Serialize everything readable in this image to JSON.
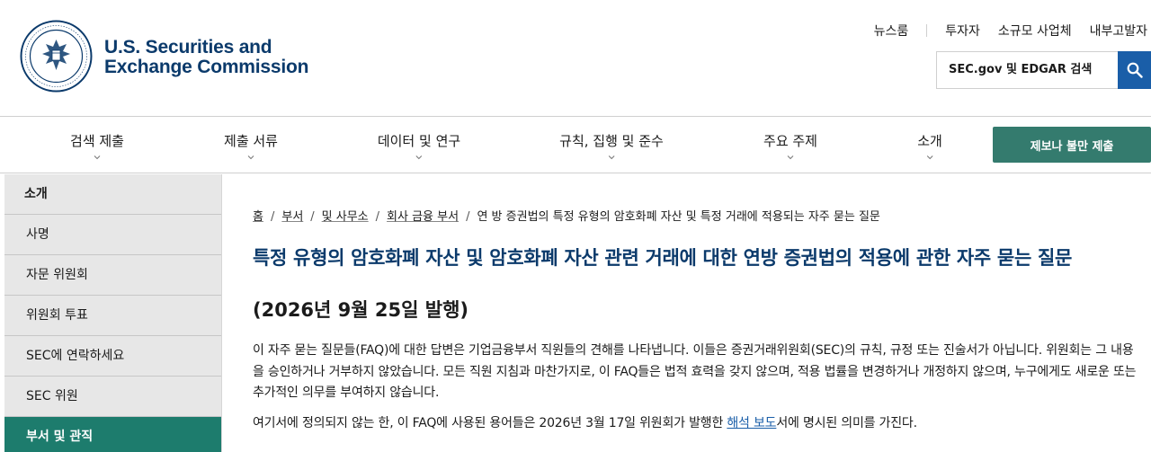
{
  "header": {
    "logo_line1": "U.S. Securities and",
    "logo_line2": "Exchange Commission",
    "utility_links": [
      "뉴스룸",
      "투자자",
      "소규모 사업체",
      "내부고발자"
    ],
    "search_placeholder": "SEC.gov 및 EDGAR 검색"
  },
  "nav": {
    "items": [
      "검색 제출",
      "제출 서류",
      "데이터 및 연구",
      "규칙, 집행 및 준수",
      "주요 주제",
      "소개"
    ],
    "tip_button": "제보나 불만 제출"
  },
  "sidebar": {
    "heading": "소개",
    "items": [
      "사명",
      "자문 위원회",
      "위원회 투표",
      "SEC에 연락하세요",
      "SEC 위원",
      "부서 및 관직"
    ],
    "active_index": 5
  },
  "breadcrumb": {
    "items": [
      "홈",
      "부서",
      "및 사무소",
      "회사 금융 부서",
      "연 방 증권법의 특정 유형의 암호화폐 자산 및 특정 거래에 적용되는 자주 묻는 질문"
    ]
  },
  "main": {
    "title": "특정 유형의 암호화폐 자산 및 암호화폐 자산 관련 거래에 대한 연방 증권법의 적용에 관한 자주 묻는 질문",
    "subtitle": "(2026년 9월 25일 발행)",
    "para1": "이 자주 묻는 질문들(FAQ)에 대한 답변은 기업금융부서 직원들의 견해를 나타냅니다. 이들은 증권거래위원회(SEC)의 규칙, 규정 또는 진술서가 아닙니다. 위원회는 그 내용을 승인하거나 거부하지 않았습니다. 모든 직원 지침과 마찬가지로, 이 FAQ들은 법적 효력을 갖지 않으며, 적용 법률을 변경하거나 개정하지 않으며, 누구에게도 새로운 또는 추가적인 의무를 부여하지 않습니다.",
    "para2_before": "여기서에 정의되지 않는 한, 이 FAQ에 사용된 용어들은 2026년 3월 17일 위원회가 발행한 ",
    "para2_link": "해석 보도",
    "para2_after": "서에 명시된 의미를 가진다."
  },
  "colors": {
    "brand_navy": "#0b3a6b",
    "search_blue": "#1a5ea8",
    "accent_green": "#347b6e",
    "sidebar_active": "#1d7c6d",
    "sidebar_bg": "#e7e7e7"
  },
  "icons": {
    "seal": "sec-seal-icon",
    "search": "search-icon",
    "chevron": "chevron-down-icon"
  }
}
